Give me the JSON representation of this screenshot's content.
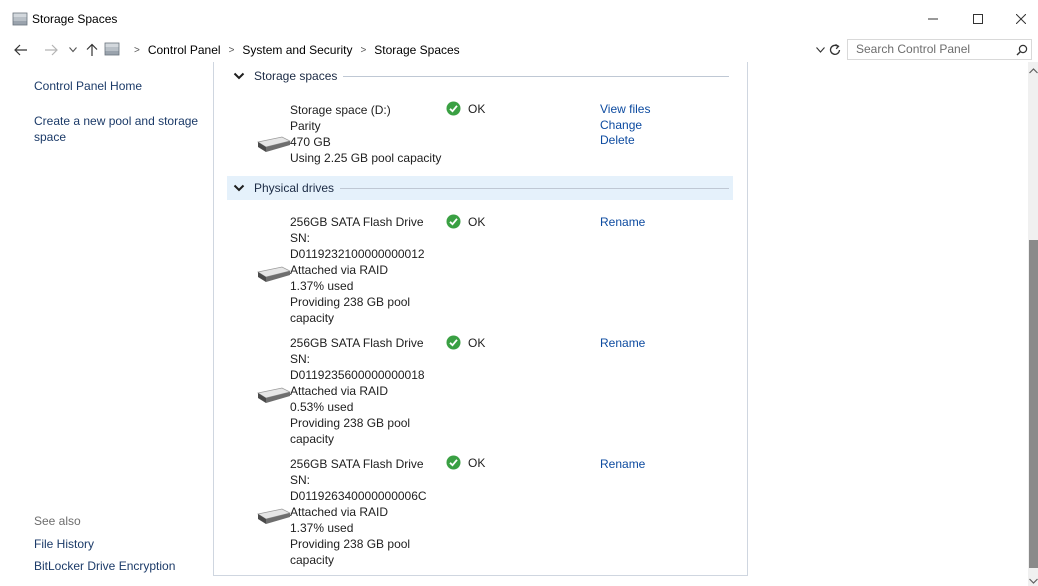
{
  "window": {
    "title": "Storage Spaces",
    "controls": [
      "minimize",
      "maximize",
      "close"
    ]
  },
  "navigation": {
    "breadcrumb": [
      "Control Panel",
      "System and Security",
      "Storage Spaces"
    ],
    "search_placeholder": "Search Control Panel"
  },
  "sidebar": {
    "home_link": "Control Panel Home",
    "create_link_line1": "Create a new pool and storage",
    "create_link_line2": "space",
    "see_also_label": "See also",
    "see_also_links": [
      "File History",
      "BitLocker Drive Encryption"
    ]
  },
  "storage_spaces": {
    "heading": "Storage spaces",
    "items": [
      {
        "lines": [
          "Storage space (D:)",
          "Parity",
          "470 GB",
          "Using 2.25 GB pool capacity"
        ],
        "status": "OK",
        "actions": [
          "View files",
          "Change",
          "Delete"
        ]
      }
    ]
  },
  "physical_drives": {
    "heading": "Physical drives",
    "items": [
      {
        "lines": [
          "256GB SATA Flash Drive",
          "SN:",
          "D0119232100000000012",
          "Attached via RAID",
          "1.37% used",
          "Providing 238 GB pool",
          "capacity"
        ],
        "status": "OK",
        "action": "Rename"
      },
      {
        "lines": [
          "256GB SATA Flash Drive",
          "SN:",
          "D0119235600000000018",
          "Attached via RAID",
          "0.53% used",
          "Providing 238 GB pool",
          "capacity"
        ],
        "status": "OK",
        "action": "Rename"
      },
      {
        "lines": [
          "256GB SATA Flash Drive",
          "SN:",
          "D011926340000000006C",
          "Attached via RAID",
          "1.37% used",
          "Providing 238 GB pool",
          "capacity"
        ],
        "status": "OK",
        "action": "Rename"
      }
    ]
  },
  "colors": {
    "link": "#0d4ba0",
    "ok_green": "#3aa043",
    "section_highlight": "#e5f1fb",
    "scroll_thumb": "#8a8a8a"
  },
  "icons": [
    "storage-spaces-app-icon",
    "back-arrow-icon",
    "forward-arrow-icon",
    "recent-dropdown-icon",
    "up-arrow-icon",
    "refresh-icon",
    "search-icon",
    "chevron-down-icon",
    "drive-icon",
    "ok-check-icon"
  ]
}
